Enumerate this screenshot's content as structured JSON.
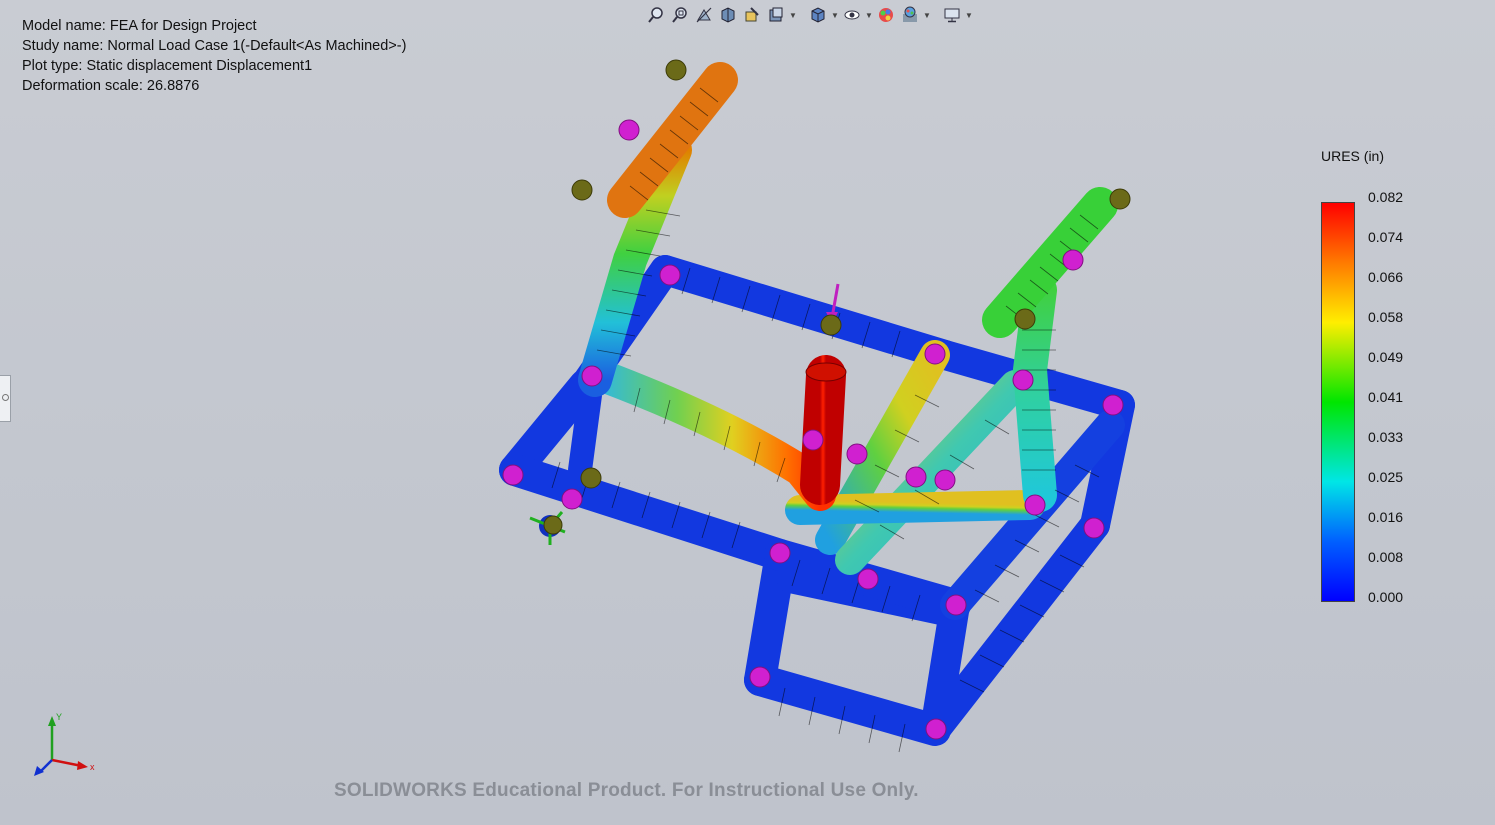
{
  "info": {
    "model_name": "Model name: FEA for Design Project",
    "study_name": "Study name: Normal Load Case 1(-Default<As Machined>-)",
    "plot_type": "Plot type: Static displacement Displacement1",
    "deformation_scale": "Deformation scale: 26.8876"
  },
  "toolbar": {
    "icons": [
      "zoom-to-fit-icon",
      "zoom-to-area-icon",
      "previous-view-icon",
      "section-view-icon",
      "view-result-icon",
      "display-style-icon",
      "view-orientation-icon",
      "hide-show-icon",
      "edit-appearance-icon",
      "apply-scene-icon",
      "view-settings-icon"
    ]
  },
  "legend": {
    "title": "URES (in)",
    "values": [
      "0.082",
      "0.074",
      "0.066",
      "0.058",
      "0.049",
      "0.041",
      "0.033",
      "0.025",
      "0.016",
      "0.008",
      "0.000"
    ],
    "colors": [
      "#ff0000",
      "#ffee00",
      "#00e600",
      "#00e6e6",
      "#0000ff"
    ]
  },
  "triad": {
    "x": "x",
    "y": "Y"
  },
  "watermark": "SOLIDWORKS Educational Product. For Instructional Use Only."
}
